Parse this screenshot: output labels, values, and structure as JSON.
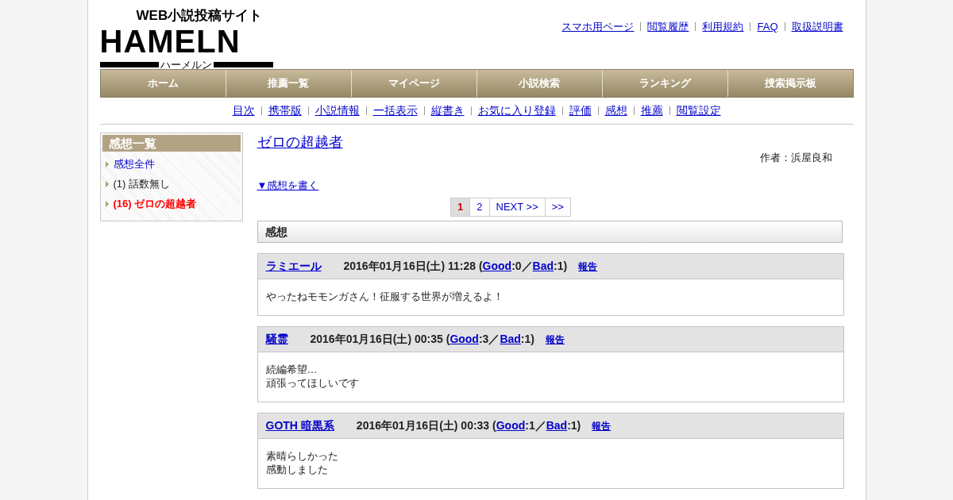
{
  "logo": {
    "tagline": "WEB小説投稿サイト",
    "wordmark": "HAMELN",
    "reading": "ハーメルン"
  },
  "top_links": [
    "スマホ用ページ",
    "閲覧履歴",
    "利用規約",
    "FAQ",
    "取扱説明書"
  ],
  "main_nav": [
    "ホーム",
    "推薦一覧",
    "マイページ",
    "小説検索",
    "ランキング",
    "捜索掲示板"
  ],
  "sub_nav": [
    "目次",
    "携帯版",
    "小説情報",
    "一括表示",
    "縦書き",
    "お気に入り登録",
    "評価",
    "感想",
    "推薦",
    "閲覧設定"
  ],
  "sidebar": {
    "title": "感想一覧",
    "items": [
      {
        "label": "感想全件",
        "kind": "link"
      },
      {
        "label": "(1) 話数無し",
        "kind": "plain"
      },
      {
        "label": "(16) ゼロの超越者",
        "kind": "current"
      }
    ]
  },
  "novel_title": "ゼロの超越者",
  "author": "作者：浜屋良和",
  "write_link": "▼感想を書く",
  "pagination": [
    {
      "label": "1",
      "selected": true
    },
    {
      "label": "2",
      "selected": false
    },
    {
      "label": "NEXT >>",
      "selected": false
    },
    {
      "label": ">>",
      "selected": false
    }
  ],
  "section_title": "感想",
  "comments": [
    {
      "author": "ラミエール",
      "meta": [
        {
          "kind": "text",
          "text": "2016年01月16日(土) 11:28 ("
        },
        {
          "kind": "link",
          "text": "Good"
        },
        {
          "kind": "text",
          "text": ":0／"
        },
        {
          "kind": "link",
          "text": "Bad"
        },
        {
          "kind": "text",
          "text": ":1)"
        }
      ],
      "report": "報告",
      "body": [
        "やったねモモンガさん！征服する世界が増えるよ！"
      ]
    },
    {
      "author": "騒霊",
      "meta": [
        {
          "kind": "text",
          "text": "2016年01月16日(土) 00:35 ("
        },
        {
          "kind": "link",
          "text": "Good"
        },
        {
          "kind": "text",
          "text": ":3／"
        },
        {
          "kind": "link",
          "text": "Bad"
        },
        {
          "kind": "text",
          "text": ":1)"
        }
      ],
      "report": "報告",
      "body": [
        "続編希望…",
        "頑張ってほしいです"
      ]
    },
    {
      "author": "GOTH 暗黒系",
      "meta": [
        {
          "kind": "text",
          "text": "2016年01月16日(土) 00:33 ("
        },
        {
          "kind": "link",
          "text": "Good"
        },
        {
          "kind": "text",
          "text": ":1／"
        },
        {
          "kind": "link",
          "text": "Bad"
        },
        {
          "kind": "text",
          "text": ":1)"
        }
      ],
      "report": "報告",
      "body": [
        "素晴らしかった",
        "感動しました"
      ]
    }
  ]
}
